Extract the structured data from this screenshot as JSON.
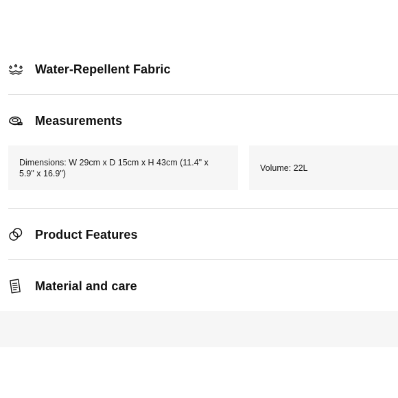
{
  "sections": [
    {
      "title": "Water-Repellent Fabric",
      "icon": "water-repellent-icon"
    },
    {
      "title": "Measurements",
      "icon": "tape-measure-icon"
    },
    {
      "title": "Product Features",
      "icon": "features-icon"
    },
    {
      "title": "Material and care",
      "icon": "care-label-icon"
    }
  ],
  "measurements": {
    "dimensions": "Dimensions: W 29cm x D 15cm x H 43cm (11.4\" x 5.9\" x 16.9\")",
    "volume": "Volume: 22L"
  }
}
